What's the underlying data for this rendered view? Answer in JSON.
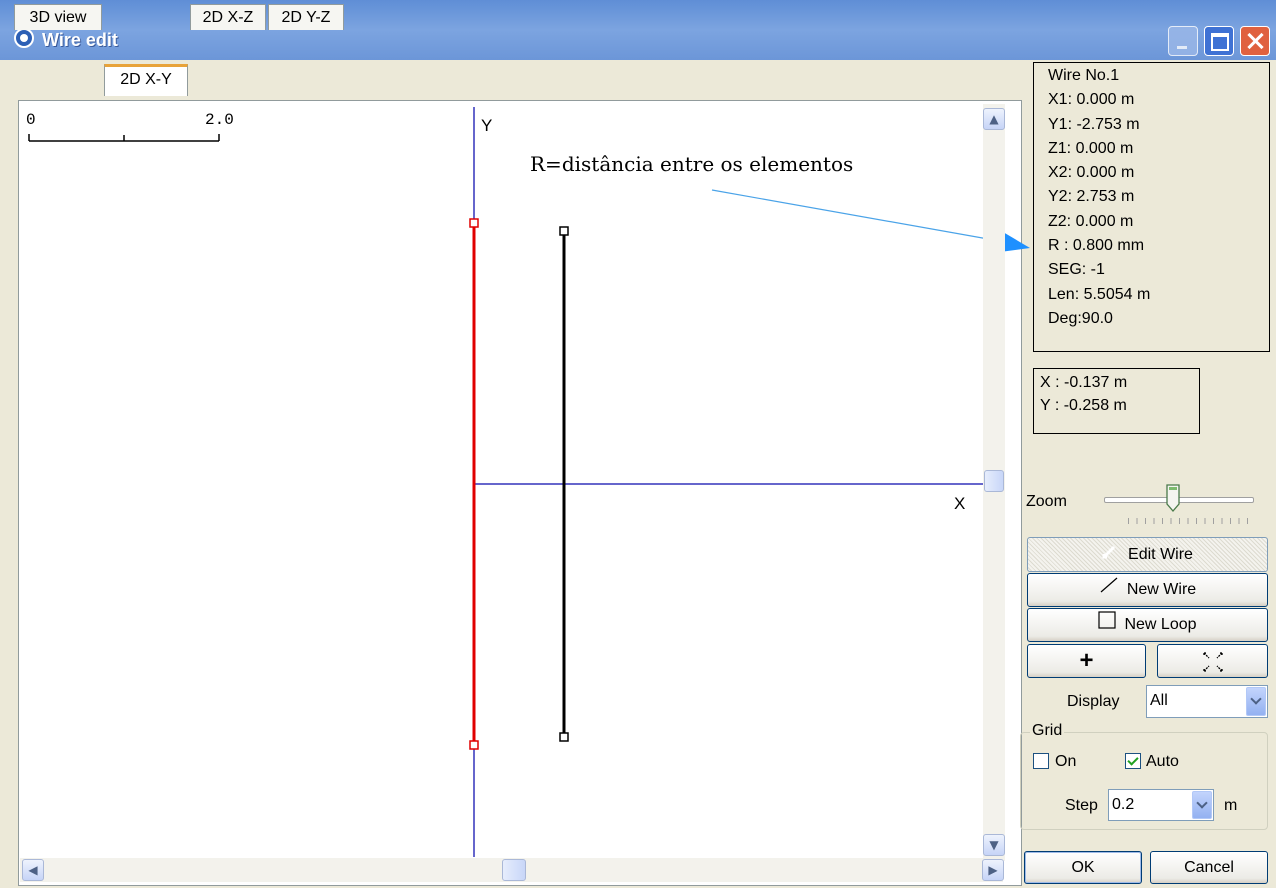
{
  "window": {
    "title": "Wire edit"
  },
  "tabs": [
    "3D view",
    "2D X-Y",
    "2D X-Z",
    "2D Y-Z"
  ],
  "active_tab": "2D X-Y",
  "canvas": {
    "scale_start": "0",
    "scale_end": "2.0",
    "axis_y_label": "Y",
    "axis_x_label": "X",
    "annotation": "R=distância entre os elementos",
    "colors": {
      "axis": "#3333bb",
      "selected_wire": "#e00000",
      "wire": "#000000",
      "annotation_arrow": "#4aa3e8"
    }
  },
  "wire_info": {
    "lines": [
      "Wire No.1",
      "X1: 0.000 m",
      "Y1: -2.753 m",
      "Z1: 0.000 m",
      "X2: 0.000 m",
      "Y2: 2.753 m",
      "Z2: 0.000 m",
      "R : 0.800 mm",
      "SEG: -1",
      "Len: 5.5054 m",
      "Deg:90.0"
    ]
  },
  "cursor": {
    "x": "X : -0.137 m",
    "y": "Y : -0.258 m"
  },
  "zoom": {
    "label": "Zoom"
  },
  "buttons": {
    "edit_wire": "Edit Wire",
    "new_wire": "New Wire",
    "new_loop": "New Loop",
    "add": "+",
    "fit": "",
    "ok": "OK",
    "cancel": "Cancel"
  },
  "display": {
    "label": "Display",
    "value": "All"
  },
  "grid": {
    "title": "Grid",
    "on_label": "On",
    "on_checked": false,
    "auto_label": "Auto",
    "auto_checked": true,
    "step_label": "Step",
    "step_value": "0.2",
    "step_unit": "m"
  }
}
